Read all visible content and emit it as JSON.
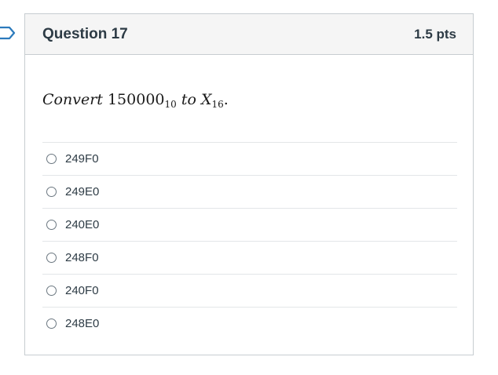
{
  "question": {
    "title": "Question 17",
    "points": "1.5 pts",
    "prompt": {
      "word_convert": "Convert",
      "number": "150000",
      "number_base": "10",
      "word_to": "to",
      "variable": "X",
      "variable_base": "16",
      "period": "."
    },
    "answers": [
      {
        "label": "249F0"
      },
      {
        "label": "249E0"
      },
      {
        "label": "240E0"
      },
      {
        "label": "248F0"
      },
      {
        "label": "240F0"
      },
      {
        "label": "248E0"
      }
    ]
  },
  "icons": {
    "flag": "flag-icon",
    "radio": "radio-button"
  },
  "colors": {
    "header_bg": "#f5f5f5",
    "border": "#c7cdd1",
    "text": "#2d3b45",
    "flag_stroke": "#2b7abc"
  }
}
